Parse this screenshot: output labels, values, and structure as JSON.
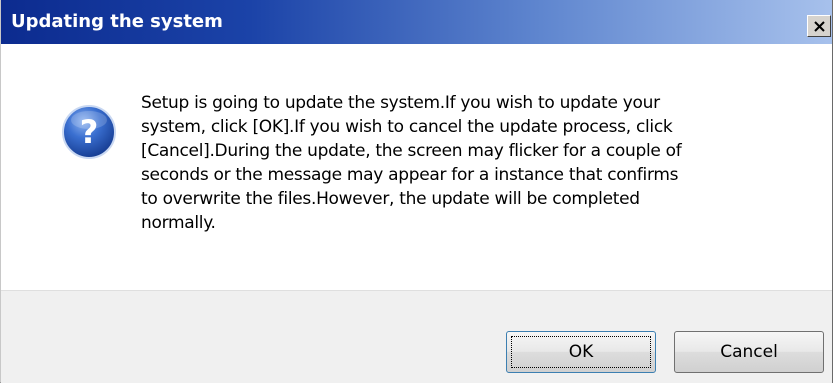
{
  "window": {
    "title": "Updating the system",
    "close_label": "×"
  },
  "message": {
    "lines": [
      "Setup is going to update the system.If you wish to update your",
      "system, click [OK].If you wish to cancel the update process, click",
      "[Cancel].During the update, the screen may flicker for a couple of",
      "seconds or the message may appear for a instance that confirms",
      "to overwrite the files.However, the update will be completed",
      "normally."
    ]
  },
  "icons": {
    "dialog_icon": "question-icon",
    "close_icon": "close-icon"
  },
  "buttons": {
    "ok_label": "OK",
    "cancel_label": "Cancel"
  },
  "colors": {
    "titlebar_start": "#0c2b8f",
    "titlebar_end": "#a7c1ec",
    "icon_blue": "#2a5fc4"
  }
}
